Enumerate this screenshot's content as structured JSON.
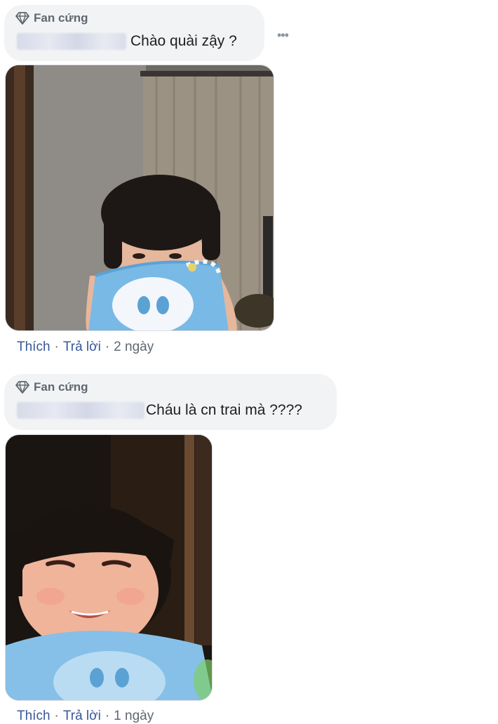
{
  "comments": [
    {
      "badge": "Fan cứng",
      "text": "Chào quài zậy ?",
      "more": "•••",
      "actions": {
        "like": "Thích",
        "reply": "Trả lời",
        "time": "2 ngày"
      },
      "separator": "·"
    },
    {
      "badge": "Fan cứng",
      "text": "Cháu là cn trai mà ????",
      "actions": {
        "like": "Thích",
        "reply": "Trả lời",
        "time": "1 ngày"
      },
      "separator": "·"
    }
  ],
  "colors": {
    "bubble": "#f2f3f5",
    "link": "#385898",
    "meta": "#606770"
  },
  "icons": {
    "badge": "diamond-icon",
    "more": "more-options-icon"
  }
}
